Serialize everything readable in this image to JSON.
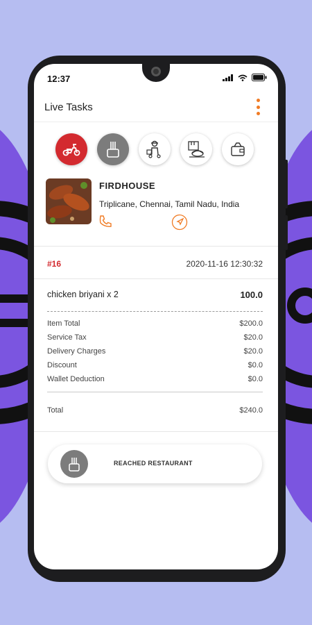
{
  "status_bar": {
    "time": "12:37"
  },
  "app_bar": {
    "title": "Live Tasks",
    "menu_icon": "more-vert-icon"
  },
  "progress_steps": [
    {
      "icon": "scooter-icon",
      "state": "active"
    },
    {
      "icon": "restaurant-icon",
      "state": "current"
    },
    {
      "icon": "delivery-person-icon",
      "state": "pending"
    },
    {
      "icon": "food-package-icon",
      "state": "pending"
    },
    {
      "icon": "wallet-icon",
      "state": "pending"
    }
  ],
  "restaurant": {
    "name": "FIRDHOUSE",
    "address": "Triplicane, Chennai, Tamil Nadu, India"
  },
  "order": {
    "id": "#16",
    "datetime": "2020-11-16 12:30:32",
    "item": {
      "name": "chicken briyani x 2",
      "price": "100.0"
    }
  },
  "bill": {
    "rows": [
      {
        "label": "Item Total",
        "value": "$200.0"
      },
      {
        "label": "Service Tax",
        "value": "$20.0"
      },
      {
        "label": "Delivery Charges",
        "value": "$20.0"
      },
      {
        "label": "Discount",
        "value": "$0.0"
      },
      {
        "label": "Wallet Deduction",
        "value": "$0.0"
      }
    ],
    "total": {
      "label": "Total",
      "value": "$240.0"
    }
  },
  "action": {
    "label": "REACHED RESTAURANT"
  },
  "colors": {
    "accent": "#f07b24",
    "red": "#d32a2f",
    "background": "#b6bdf1",
    "purple": "#7b55e0"
  }
}
